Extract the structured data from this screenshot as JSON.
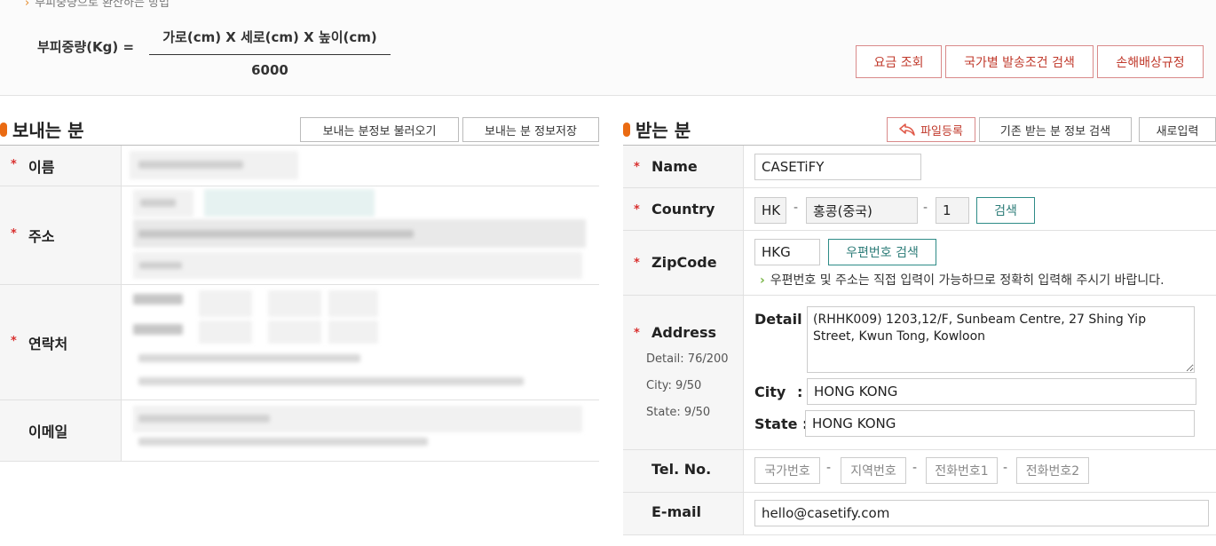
{
  "formula": {
    "top_note": "부피중량으로 환산하는 방법",
    "label": "부피중량(Kg) =",
    "numerator": "가로(cm) X 세로(cm) X 높이(cm)",
    "denominator": "6000"
  },
  "top_buttons": {
    "rate": "요금 조회",
    "country_search": "국가별 발송조건 검색",
    "compensation": "손해배상규정"
  },
  "sender": {
    "title": "보내는 분",
    "load_button": "보내는 분정보 불러오기",
    "save_button": "보내는 분 정보저장",
    "labels": {
      "name": "이름",
      "address": "주소",
      "contact": "연락처",
      "email": "이메일"
    }
  },
  "receiver": {
    "title": "받는 분",
    "file_button": "파일등록",
    "search_button": "기존 받는 분 정보 검색",
    "new_button": "새로입력",
    "labels": {
      "name": "Name",
      "country": "Country",
      "zipcode": "ZipCode",
      "address": "Address",
      "tel": "Tel. No.",
      "email": "E-mail"
    },
    "name_value": "CASETiFY",
    "country": {
      "code": "HK",
      "name": "홍콩(중국)",
      "num": "1",
      "search": "검색"
    },
    "zipcode": {
      "value": "HKG",
      "search": "우편번호 검색",
      "note": "우편번호 및 주소는 직접 입력이 가능하므로 정확히 입력해 주시기 바랍니다."
    },
    "address": {
      "detail_counter": "Detail: 76/200",
      "city_counter": "City: 9/50",
      "state_counter": "State: 9/50",
      "detail_label": "Detail :",
      "detail_value": "(RHHK009) 1203,12/F, Sunbeam Centre, 27 Shing Yip Street, Kwun Tong, Kowloon",
      "city_label": "City",
      "city_colon": ":",
      "city_value": "HONG KONG",
      "state_label": "State :",
      "state_value": "HONG KONG"
    },
    "tel_placeholders": {
      "country": "국가번호",
      "area": "지역번호",
      "phone1": "전화번호1",
      "phone2": "전화번호2"
    },
    "email_value": "hello@casetify.com"
  },
  "colors": {
    "accent": "#ea6b12",
    "required": "#d9302f",
    "teal": "#2e8b87",
    "red_button": "#c0392b"
  }
}
